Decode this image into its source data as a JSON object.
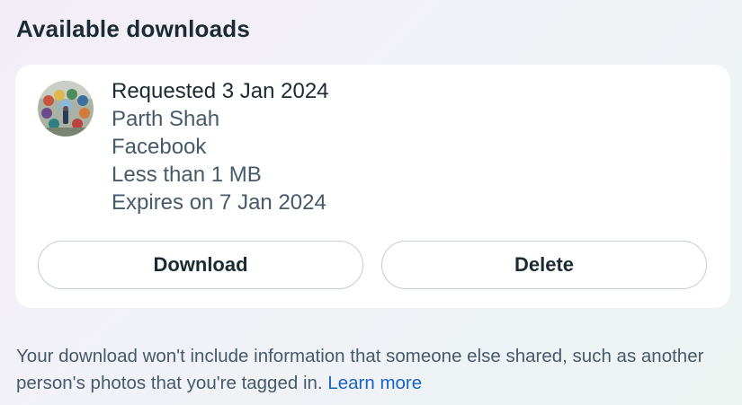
{
  "section": {
    "title": "Available downloads"
  },
  "download_request": {
    "requested": "Requested 3 Jan 2024",
    "name": "Parth Shah",
    "platform": "Facebook",
    "size": "Less than 1 MB",
    "expires": "Expires on 7 Jan 2024",
    "avatar": "profile-photo"
  },
  "actions": {
    "download_label": "Download",
    "delete_label": "Delete"
  },
  "footnote": {
    "text": "Your download won't include information that someone else shared, such as another person's photos that you're tagged in.",
    "link_label": "Learn more"
  }
}
